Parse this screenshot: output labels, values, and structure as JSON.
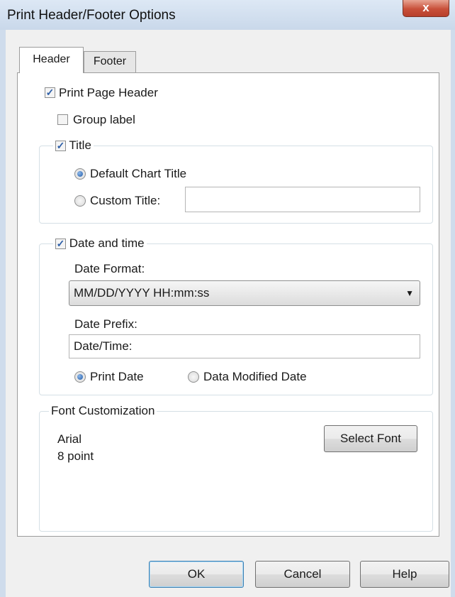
{
  "window": {
    "title": "Print Header/Footer Options",
    "close_label": "x"
  },
  "tabs": [
    {
      "label": "Header",
      "selected": true
    },
    {
      "label": "Footer",
      "selected": false
    }
  ],
  "header": {
    "print_page_header": {
      "label": "Print Page Header",
      "checked": true
    },
    "group_label": {
      "label": "Group label",
      "checked": false
    },
    "title_group": {
      "label": "Title",
      "checked": true,
      "default_title": {
        "label": "Default Chart Title",
        "selected": true
      },
      "custom_title": {
        "label": "Custom Title:",
        "selected": false,
        "value": ""
      }
    },
    "date_group": {
      "label": "Date and time",
      "checked": true,
      "format_label": "Date Format:",
      "format_value": "MM/DD/YYYY HH:mm:ss",
      "prefix_label": "Date Prefix:",
      "prefix_value": "Date/Time:",
      "print_date": {
        "label": "Print Date",
        "selected": true
      },
      "modified_date": {
        "label": "Data Modified Date",
        "selected": false
      }
    },
    "font_group": {
      "label": "Font Customization",
      "font_name": "Arial",
      "font_size": "8 point",
      "select_font_label": "Select Font"
    }
  },
  "buttons": {
    "ok": "OK",
    "cancel": "Cancel",
    "help": "Help"
  },
  "colors": {
    "check_mark": "#2d5fa8",
    "radio_dot": "#1f5aa8",
    "close_button": "#c8503a"
  }
}
